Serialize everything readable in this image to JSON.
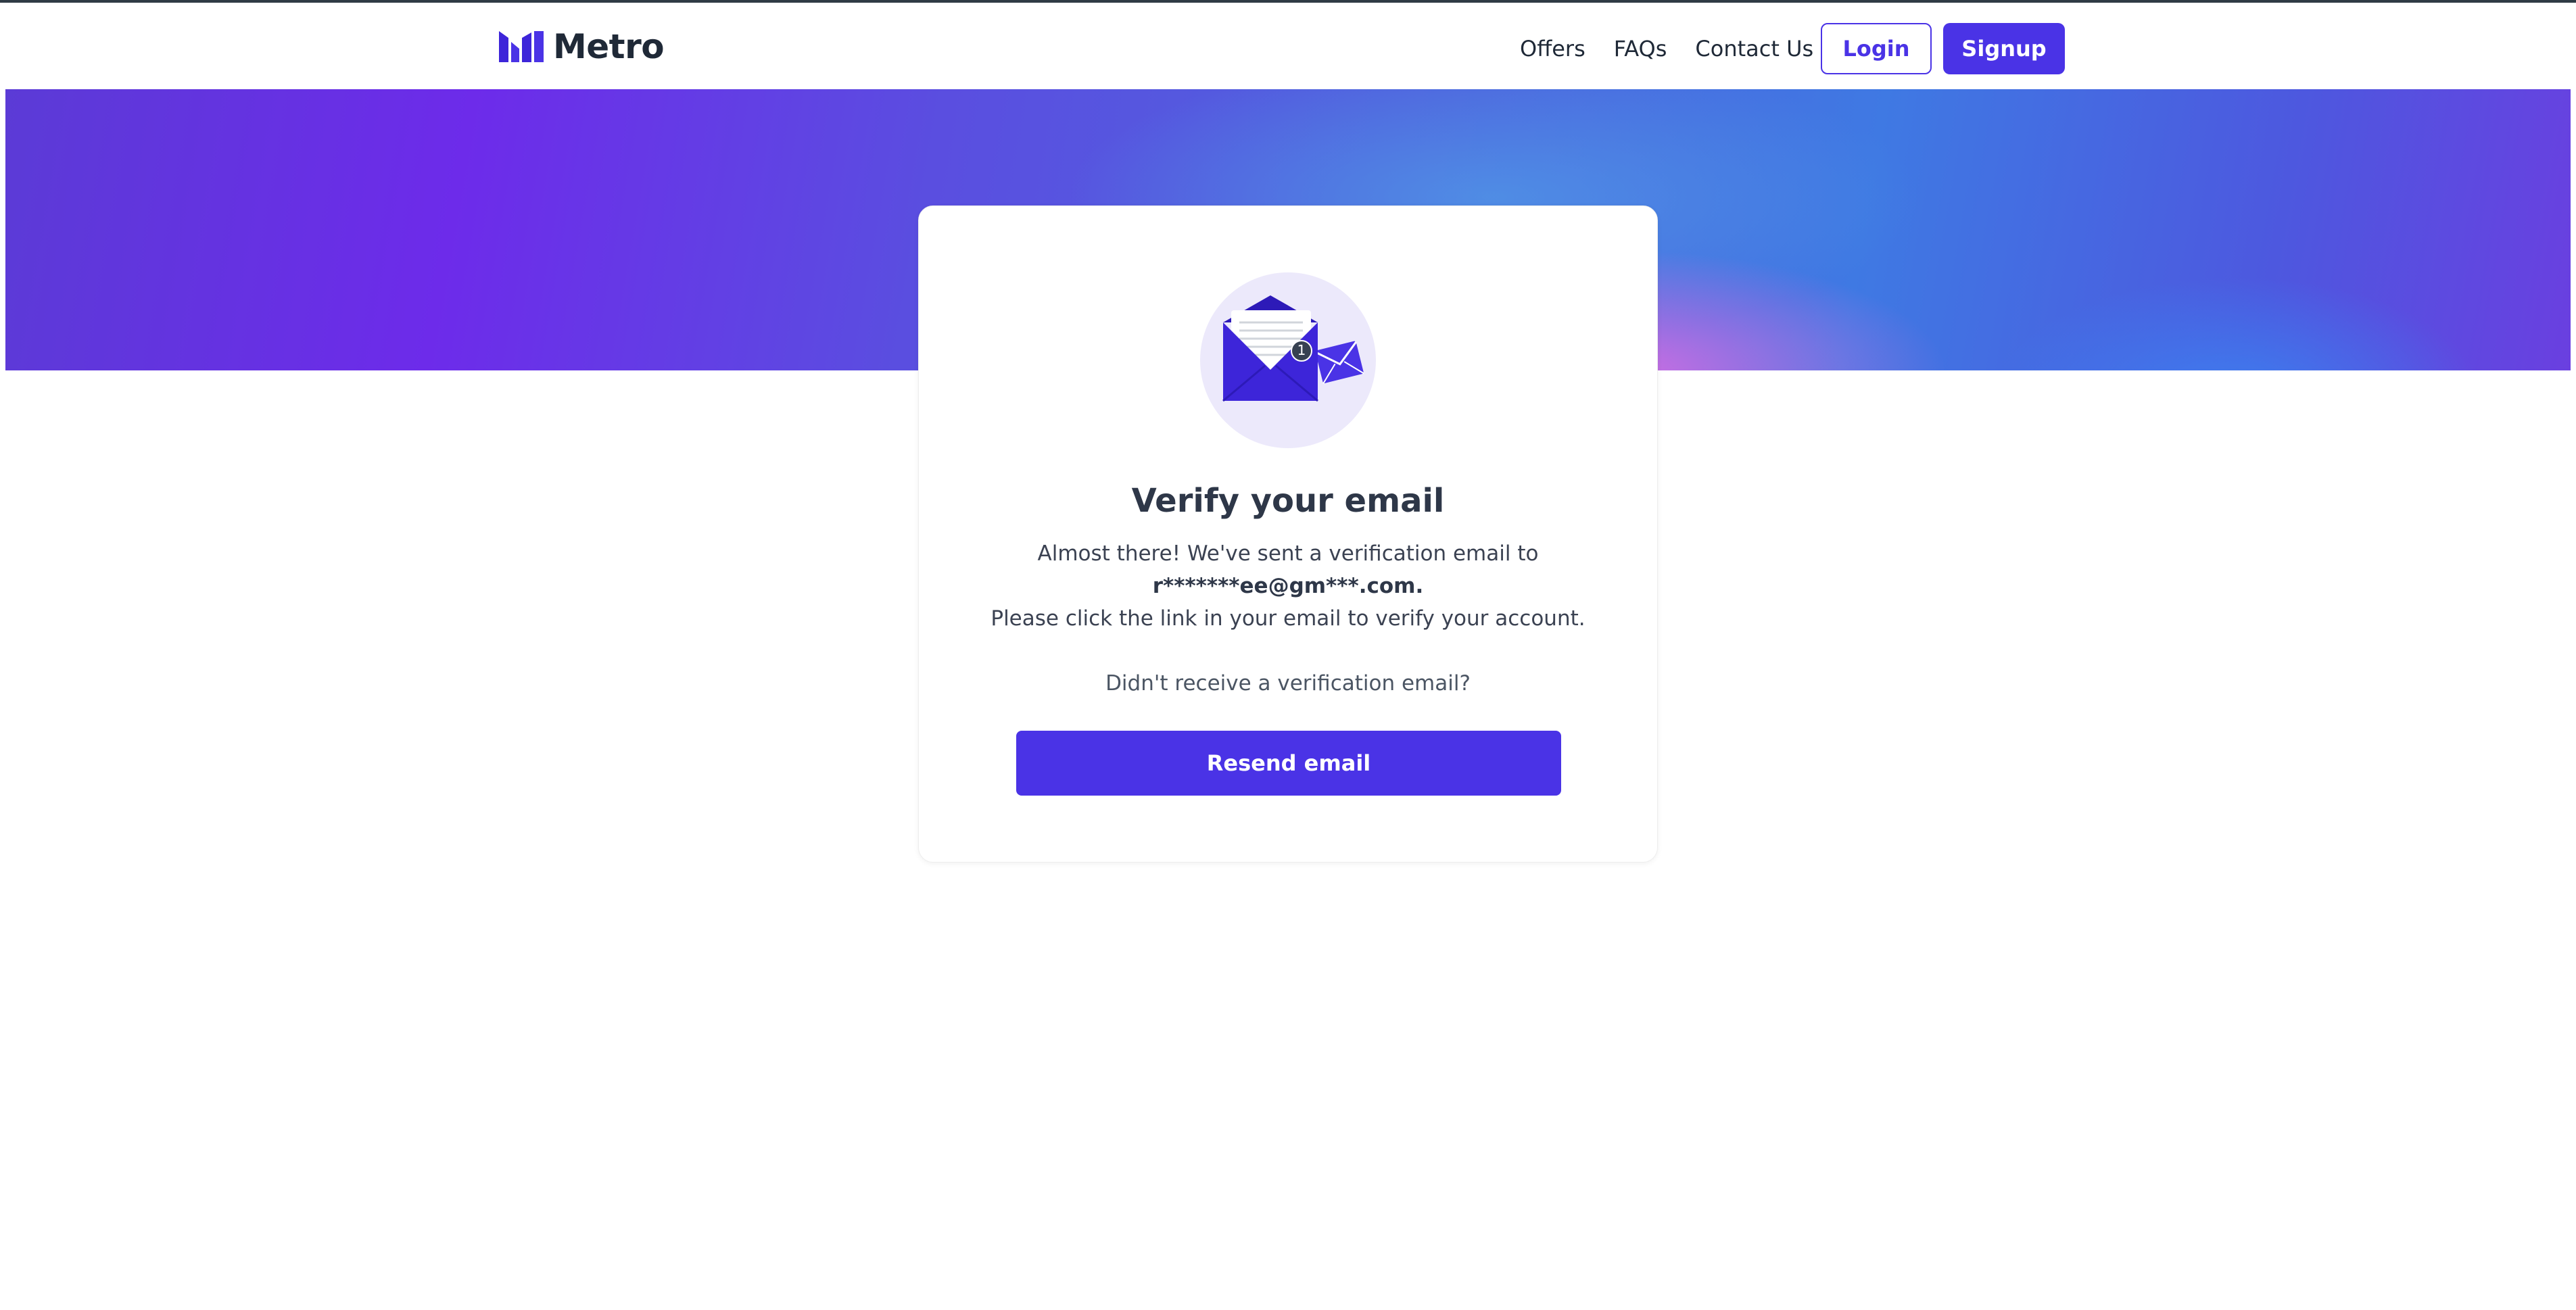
{
  "brand": {
    "name": "Metro",
    "icon": "metro-logo-icon",
    "color": "#4a33e6"
  },
  "nav": {
    "links": [
      "Offers",
      "FAQs",
      "Contact Us"
    ],
    "login_label": "Login",
    "signup_label": "Signup"
  },
  "card": {
    "icon": "envelope-mail-icon",
    "badge_count": "1",
    "title": "Verify your email",
    "line1": "Almost there! We've sent a verification email to",
    "email": "r*******ee@gm***.com.",
    "line3": "Please click the link in your email to verify your account.",
    "prompt": "Didn't receive a verification email?",
    "resend_label": "Resend email"
  },
  "colors": {
    "accent": "#4a33e6",
    "hero_start": "#6d2bea",
    "hero_end": "#3f79e3"
  }
}
